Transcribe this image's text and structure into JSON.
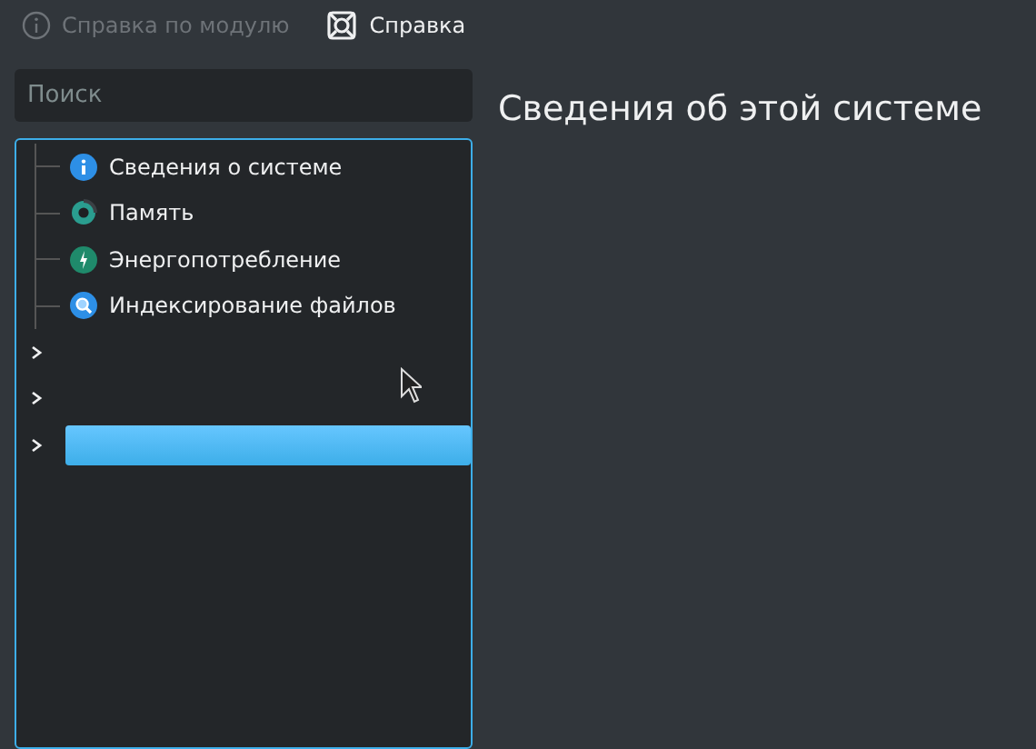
{
  "toolbar": [
    {
      "label": "Справка по модулю",
      "disabled": true
    },
    {
      "label": "Справка",
      "disabled": false
    }
  ],
  "search": {
    "placeholder": "Поиск"
  },
  "tree": [
    {
      "kind": "leaf",
      "label": "Сведения о системе",
      "selected": false
    },
    {
      "kind": "leaf",
      "label": "Память",
      "selected": false
    },
    {
      "kind": "leaf",
      "label": "Энергопотребление",
      "selected": false
    },
    {
      "kind": "leaf",
      "label": "Индексирование файлов",
      "selected": false
    },
    {
      "kind": "group",
      "expanded": false,
      "selected": false
    },
    {
      "kind": "group",
      "expanded": false,
      "selected": false
    },
    {
      "kind": "group",
      "expanded": false,
      "selected": true
    }
  ],
  "page": {
    "title": "Сведения об этой системе"
  }
}
